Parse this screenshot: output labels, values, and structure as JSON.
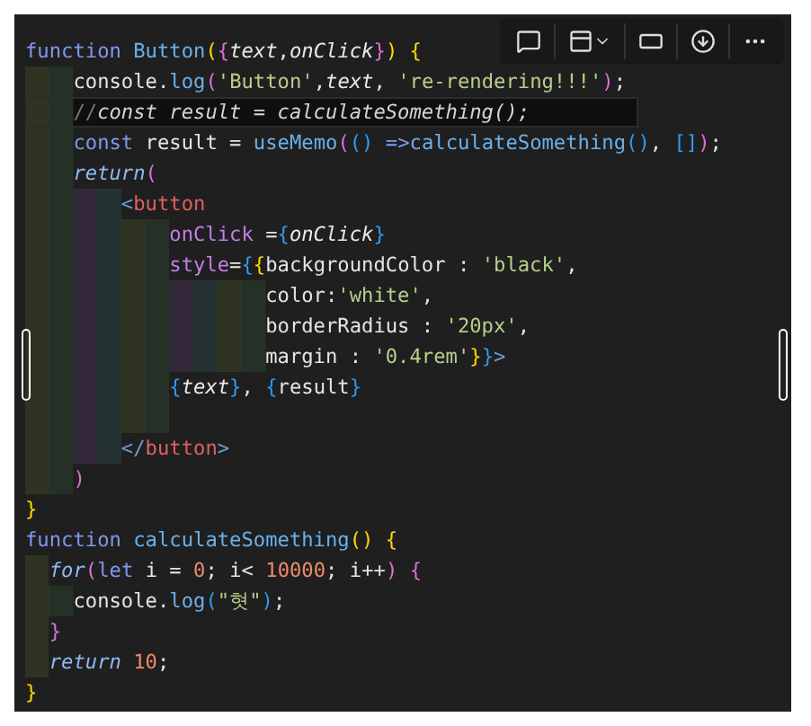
{
  "editor": {
    "lines": [
      {
        "current": false,
        "tokens": [
          {
            "text": "function",
            "kind": "kw"
          },
          {
            "text": " Button",
            "kind": "fn"
          },
          {
            "text": "(",
            "kind": "b1"
          },
          {
            "text": "{",
            "kind": "b2"
          },
          {
            "text": "text",
            "kind": "param"
          },
          {
            "text": ",",
            "kind": "plain"
          },
          {
            "text": "onClick",
            "kind": "param"
          },
          {
            "text": "}",
            "kind": "b2"
          },
          {
            "text": ")",
            "kind": "b1"
          },
          {
            "text": " {",
            "kind": "b1"
          }
        ]
      },
      {
        "current": false,
        "tokens": [
          {
            "text": "    console.",
            "kind": "plain"
          },
          {
            "text": "log",
            "kind": "fn"
          },
          {
            "text": "(",
            "kind": "b2"
          },
          {
            "text": "'Button'",
            "kind": "str"
          },
          {
            "text": ",",
            "kind": "plain"
          },
          {
            "text": "text",
            "kind": "param"
          },
          {
            "text": ", ",
            "kind": "plain"
          },
          {
            "text": "'re-rendering!!!'",
            "kind": "str"
          },
          {
            "text": ")",
            "kind": "b2"
          },
          {
            "text": ";",
            "kind": "plain"
          }
        ]
      },
      {
        "current": true,
        "tokens": [
          {
            "text": "    //",
            "kind": "commentmark"
          },
          {
            "text": "const result = calculateSomething();",
            "kind": "comment"
          }
        ]
      },
      {
        "current": false,
        "tokens": [
          {
            "text": "    const",
            "kind": "kw"
          },
          {
            "text": " result = ",
            "kind": "plain"
          },
          {
            "text": "useMemo",
            "kind": "fn"
          },
          {
            "text": "(",
            "kind": "b2"
          },
          {
            "text": "()",
            "kind": "b3"
          },
          {
            "text": " =>",
            "kind": "kw"
          },
          {
            "text": "calculateSomething",
            "kind": "fn"
          },
          {
            "text": "()",
            "kind": "b3"
          },
          {
            "text": ", ",
            "kind": "plain"
          },
          {
            "text": "[]",
            "kind": "b3"
          },
          {
            "text": ")",
            "kind": "b2"
          },
          {
            "text": ";",
            "kind": "plain"
          }
        ]
      },
      {
        "current": false,
        "tokens": [
          {
            "text": "    return",
            "kind": "kwi"
          },
          {
            "text": "(",
            "kind": "b2"
          }
        ]
      },
      {
        "current": false,
        "tokens": [
          {
            "text": "        <",
            "kind": "tagp"
          },
          {
            "text": "button",
            "kind": "tag"
          }
        ]
      },
      {
        "current": false,
        "tokens": [
          {
            "text": "            onClick",
            "kind": "attr"
          },
          {
            "text": " =",
            "kind": "plain"
          },
          {
            "text": "{",
            "kind": "b3"
          },
          {
            "text": "onClick",
            "kind": "param"
          },
          {
            "text": "}",
            "kind": "b3"
          }
        ]
      },
      {
        "current": false,
        "tokens": [
          {
            "text": "            style",
            "kind": "attr"
          },
          {
            "text": "=",
            "kind": "plain"
          },
          {
            "text": "{",
            "kind": "b3"
          },
          {
            "text": "{",
            "kind": "b1"
          },
          {
            "text": "backgroundColor : ",
            "kind": "plain"
          },
          {
            "text": "'black'",
            "kind": "str"
          },
          {
            "text": ",",
            "kind": "plain"
          }
        ]
      },
      {
        "current": false,
        "tokens": [
          {
            "text": "                    color:",
            "kind": "plain"
          },
          {
            "text": "'white'",
            "kind": "str"
          },
          {
            "text": ",",
            "kind": "plain"
          }
        ]
      },
      {
        "current": false,
        "tokens": [
          {
            "text": "                    borderRadius : ",
            "kind": "plain"
          },
          {
            "text": "'20px'",
            "kind": "str"
          },
          {
            "text": ",",
            "kind": "plain"
          }
        ]
      },
      {
        "current": false,
        "tokens": [
          {
            "text": "                    margin : ",
            "kind": "plain"
          },
          {
            "text": "'0.4rem'",
            "kind": "str"
          },
          {
            "text": "}",
            "kind": "b1"
          },
          {
            "text": "}",
            "kind": "b3"
          },
          {
            "text": ">",
            "kind": "tagp"
          }
        ]
      },
      {
        "current": false,
        "tokens": [
          {
            "text": "            {",
            "kind": "b3"
          },
          {
            "text": "text",
            "kind": "param"
          },
          {
            "text": "}",
            "kind": "b3"
          },
          {
            "text": ", ",
            "kind": "plain"
          },
          {
            "text": "{",
            "kind": "b3"
          },
          {
            "text": "result",
            "kind": "plain"
          },
          {
            "text": "}",
            "kind": "b3"
          }
        ]
      },
      {
        "current": false
      },
      {
        "current": false,
        "tokens": [
          {
            "text": "        </",
            "kind": "tagp"
          },
          {
            "text": "button",
            "kind": "tag"
          },
          {
            "text": ">",
            "kind": "tagp"
          }
        ]
      },
      {
        "current": false,
        "tokens": [
          {
            "text": "    )",
            "kind": "b2"
          }
        ]
      },
      {
        "current": false,
        "tokens": [
          {
            "text": "}",
            "kind": "b1"
          }
        ]
      },
      {
        "current": false,
        "tokens": [
          {
            "text": "function",
            "kind": "kw"
          },
          {
            "text": " calculateSomething",
            "kind": "fn"
          },
          {
            "text": "()",
            "kind": "b1"
          },
          {
            "text": " {",
            "kind": "b1"
          }
        ]
      },
      {
        "current": false,
        "tokens": [
          {
            "text": "  for",
            "kind": "kwi"
          },
          {
            "text": "(",
            "kind": "b2"
          },
          {
            "text": "let",
            "kind": "kw"
          },
          {
            "text": " i = ",
            "kind": "plain"
          },
          {
            "text": "0",
            "kind": "num"
          },
          {
            "text": "; i< ",
            "kind": "plain"
          },
          {
            "text": "10000",
            "kind": "num"
          },
          {
            "text": "; i++",
            "kind": "plain"
          },
          {
            "text": ")",
            "kind": "b2"
          },
          {
            "text": " {",
            "kind": "b2"
          }
        ]
      },
      {
        "current": false,
        "tokens": [
          {
            "text": "    console.",
            "kind": "plain"
          },
          {
            "text": "log",
            "kind": "fn"
          },
          {
            "text": "(",
            "kind": "b3"
          },
          {
            "text": "\"혓\"",
            "kind": "str"
          },
          {
            "text": ")",
            "kind": "b3"
          },
          {
            "text": ";",
            "kind": "plain"
          }
        ]
      },
      {
        "current": false,
        "tokens": [
          {
            "text": "  }",
            "kind": "b2"
          }
        ]
      },
      {
        "current": false,
        "tokens": [
          {
            "text": "  return",
            "kind": "kwi"
          },
          {
            "text": " 10",
            "kind": "num"
          },
          {
            "text": ";",
            "kind": "plain"
          }
        ]
      },
      {
        "current": false,
        "tokens": [
          {
            "text": "}",
            "kind": "b1"
          }
        ]
      }
    ]
  }
}
